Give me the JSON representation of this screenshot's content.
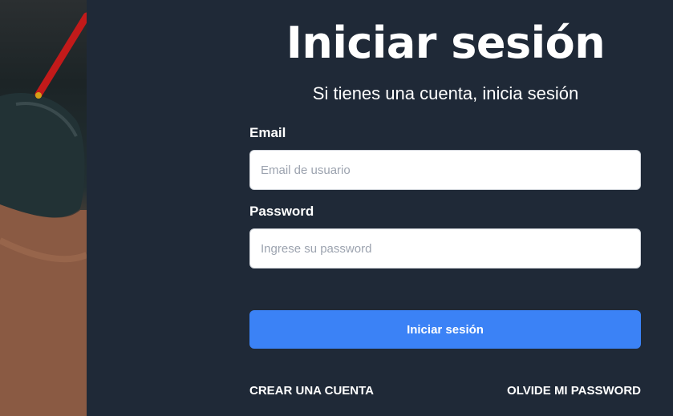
{
  "login": {
    "title": "Iniciar sesión",
    "subtitle": "Si tienes una cuenta, inicia sesión",
    "email_label": "Email",
    "email_placeholder": "Email de usuario",
    "email_value": "",
    "password_label": "Password",
    "password_placeholder": "Ingrese su password",
    "password_value": "",
    "submit_label": "Iniciar sesión"
  },
  "links": {
    "create_account": "CREAR UNA CUENTA",
    "forgot_password": "OLVIDE MI PASSWORD"
  },
  "colors": {
    "panel_background": "#1f2937",
    "primary_button": "#3b82f6",
    "text": "#ffffff"
  }
}
